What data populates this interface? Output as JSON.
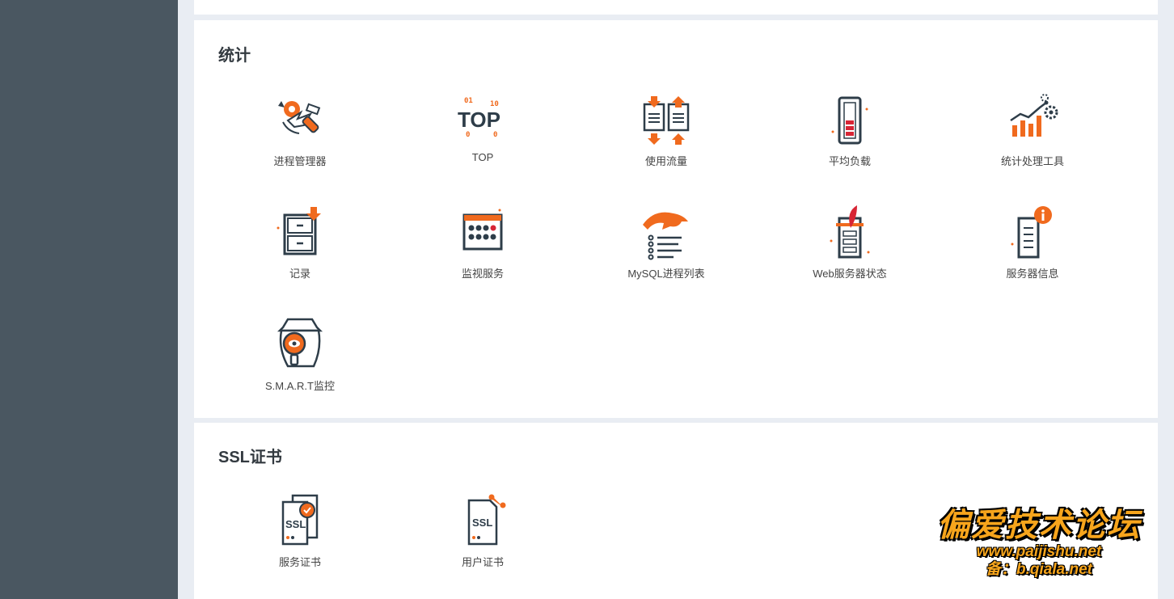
{
  "sections": {
    "stats": {
      "title": "统计",
      "tools": [
        {
          "label": "进程管理器",
          "icon": "process-manager-icon"
        },
        {
          "label": "TOP",
          "icon": "top-icon"
        },
        {
          "label": "使用流量",
          "icon": "traffic-icon"
        },
        {
          "label": "平均负载",
          "icon": "load-average-icon"
        },
        {
          "label": "统计处理工具",
          "icon": "stats-tool-icon"
        },
        {
          "label": "记录",
          "icon": "log-cabinet-icon"
        },
        {
          "label": "监视服务",
          "icon": "monitor-service-icon"
        },
        {
          "label": "MySQL进程列表",
          "icon": "mysql-dolphin-icon"
        },
        {
          "label": "Web服务器状态",
          "icon": "web-server-status-icon"
        },
        {
          "label": "服务器信息",
          "icon": "server-info-icon"
        },
        {
          "label": "S.M.A.R.T监控",
          "icon": "smart-monitor-icon"
        }
      ]
    },
    "ssl": {
      "title": "SSL证书",
      "tools": [
        {
          "label": "服务证书",
          "icon": "service-certificate-icon"
        },
        {
          "label": "用户证书",
          "icon": "user-certificate-icon"
        }
      ]
    }
  },
  "watermark": {
    "title": "偏爱技术论坛",
    "url": "www.paijishu.net",
    "sub": "备：b.qiala.net"
  },
  "colors": {
    "sidebar": "#4a5761",
    "accent": "#f06a1e",
    "icon_dark": "#2e3d49",
    "background": "#e9edf3"
  }
}
